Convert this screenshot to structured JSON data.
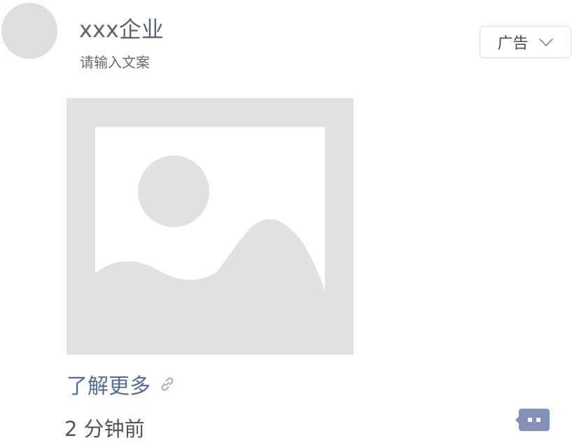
{
  "post": {
    "author_name": "xxx企业",
    "caption": "请输入文案",
    "ad_tag": {
      "label": "广告",
      "icon": "chevron-down-icon"
    },
    "media": {
      "icon": "image-placeholder-icon"
    },
    "link": {
      "label": "了解更多",
      "icon": "link-icon"
    },
    "timestamp": "2 分钟前",
    "comment_button_icon": "comment-dots-icon"
  },
  "colors": {
    "avatar": "#dedede",
    "placeholder": "#e1e1e1",
    "name_text": "#5b6574",
    "link_blue": "#576b95",
    "comment_icon": "#8391b8",
    "timestamp_text": "#555555"
  }
}
